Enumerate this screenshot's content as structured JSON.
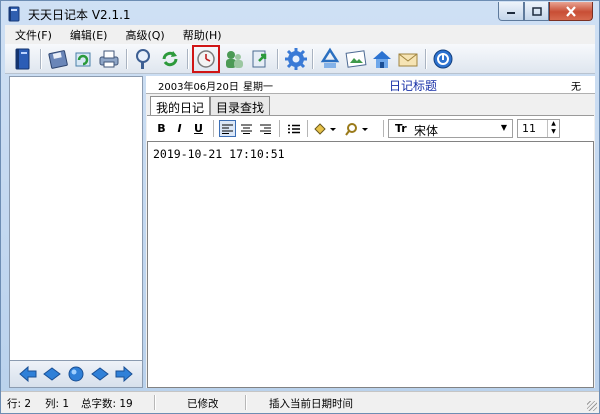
{
  "window": {
    "title": "天天日记本 V2.1.1"
  },
  "menu": [
    {
      "label": "文件(F)"
    },
    {
      "label": "编辑(E)"
    },
    {
      "label": "高级(Q)"
    },
    {
      "label": "帮助(H)"
    }
  ],
  "toolbar": {
    "icons": [
      "diary-book-icon",
      "save-icon",
      "refresh-icon",
      "print-icon",
      "find-icon",
      "reload-icon",
      "insert-time-icon",
      "users-icon",
      "export-icon",
      "settings-icon",
      "recycle-icon",
      "photo-icon",
      "home-icon",
      "email-icon",
      "about-icon"
    ],
    "highlighted": "insert-time-icon",
    "highlight_color": "#d01515"
  },
  "header": {
    "date": "2003年06月20日",
    "weekday": "星期一",
    "diary_title": "日记标题",
    "weather": "无"
  },
  "tabs": [
    {
      "label": "我的日记",
      "active": true
    },
    {
      "label": "目录查找",
      "active": false
    }
  ],
  "format": {
    "bold": "B",
    "italic": "I",
    "underline": "U",
    "font_glyph": "Tr",
    "font_name": "宋体",
    "font_size": "11"
  },
  "editor": {
    "content": "2019-10-21 17:10:51"
  },
  "status": {
    "row": "行: 2",
    "col": "列: 1",
    "word_count": "总字数: 19",
    "modified": "已修改",
    "message": "插入当前日期时间"
  },
  "colors": {
    "title_text": "#1a32a8",
    "window_frame": "#b9d1ec"
  }
}
